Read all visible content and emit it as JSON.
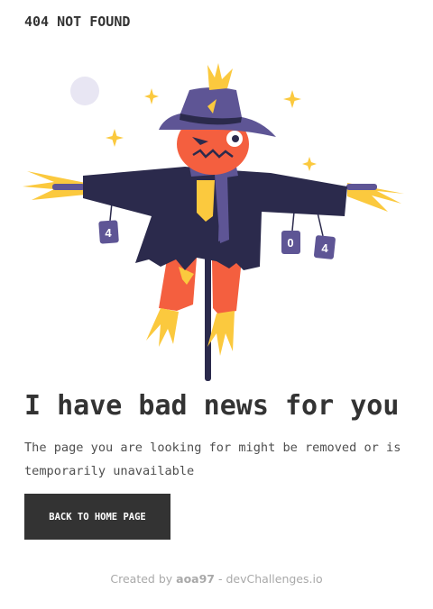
{
  "header": {
    "title": "404 NOT FOUND"
  },
  "illustration": {
    "tag_1": "4",
    "tag_2": "0",
    "tag_3": "4"
  },
  "main": {
    "headline": "I have bad news for you",
    "message": "The page you are looking for might be removed or is temporarily unavailable",
    "button_label": "BACK TO HOME PAGE"
  },
  "footer": {
    "prefix": "Created by ",
    "author": "aoa97",
    "separator": " - ",
    "site": "devChallenges.io"
  },
  "colors": {
    "text_dark": "#333333",
    "hat_purple": "#5e5595",
    "coat_navy": "#2b2a4c",
    "face_orange": "#f45f3f",
    "straw_yellow": "#fbc93e",
    "moon_lavender": "#e8e6f3"
  }
}
